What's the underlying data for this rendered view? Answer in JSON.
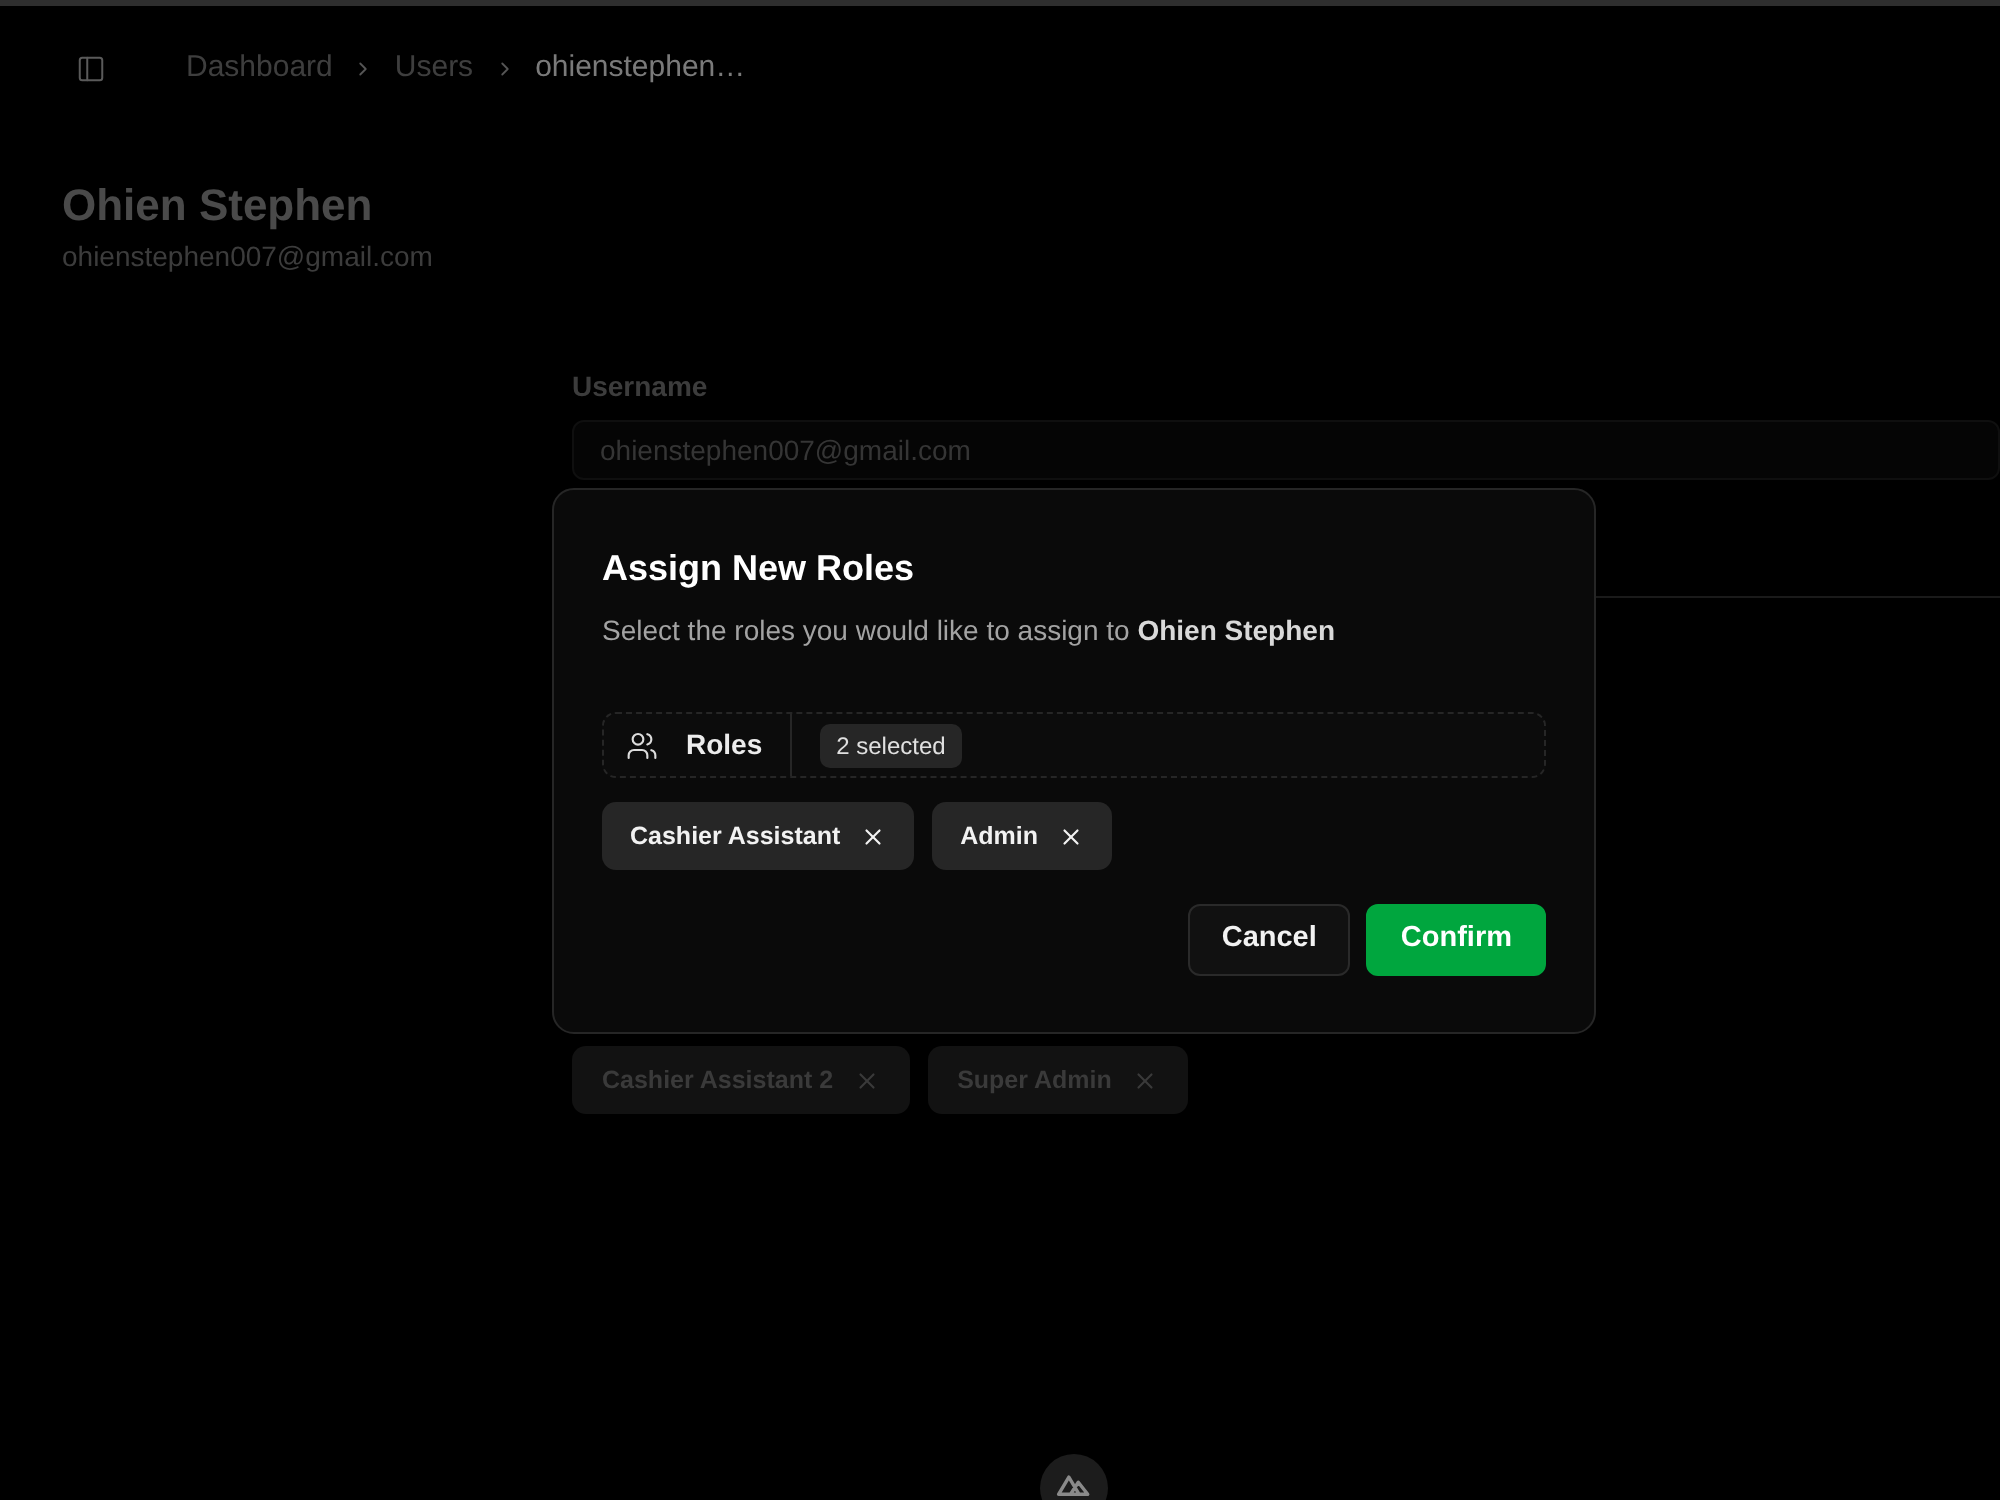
{
  "header": {
    "breadcrumb": [
      {
        "label": "Dashboard",
        "current": false
      },
      {
        "label": "Users",
        "current": false
      },
      {
        "label": "ohienstephen…",
        "current": true
      }
    ]
  },
  "profile": {
    "name": "Ohien Stephen",
    "email": "ohienstephen007@gmail.com"
  },
  "form": {
    "fields": [
      {
        "label": "Username",
        "value": "ohienstephen007@gmail.com"
      }
    ],
    "roles": [
      {
        "label": "Cashier Assistant 2"
      },
      {
        "label": "Super Admin"
      }
    ]
  },
  "dialog": {
    "title": "Assign New Roles",
    "description": "Select the roles you would like to assign to **Ohien Stephen**",
    "select": {
      "label": "Roles",
      "summary": "2 selected"
    },
    "chips": [
      {
        "label": "Cashier Assistant"
      },
      {
        "label": "Admin"
      }
    ],
    "buttons": [
      {
        "label": "Cancel",
        "kind": "secondary"
      },
      {
        "label": "Confirm",
        "kind": "primary"
      }
    ]
  }
}
